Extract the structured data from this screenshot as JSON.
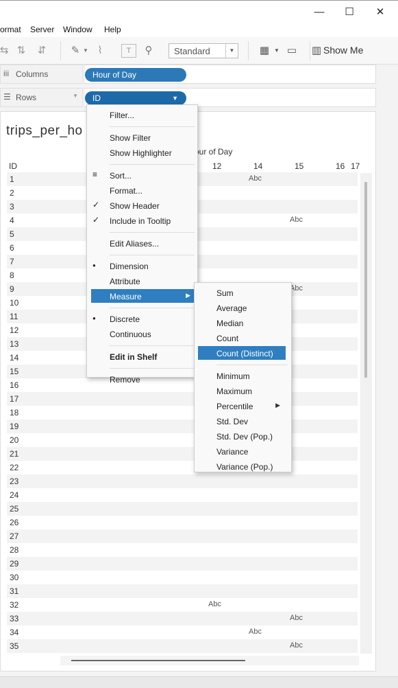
{
  "window": {
    "minimize": "—",
    "maximize": "☐",
    "close": "✕"
  },
  "menu": [
    "ormat",
    "Server",
    "Window",
    "Help"
  ],
  "toolbar": {
    "mode_value": "Standard",
    "show_me": "Show Me"
  },
  "shelves": {
    "columns_label": "Columns",
    "columns_pill": "Hour of Day",
    "rows_label": "Rows",
    "rows_pill": "ID"
  },
  "sheet": {
    "title": "trips_per_ho",
    "column_header": "our of Day",
    "id_header": "ID",
    "hour_ticks": [
      "12",
      "14",
      "15",
      "16",
      "17"
    ],
    "rows": [
      {
        "id": "1",
        "abc": "Abc",
        "col": "14"
      },
      {
        "id": "2"
      },
      {
        "id": "3"
      },
      {
        "id": "4",
        "abc": "Abc",
        "col": "15"
      },
      {
        "id": "5"
      },
      {
        "id": "6"
      },
      {
        "id": "7"
      },
      {
        "id": "8"
      },
      {
        "id": "9",
        "abc": "Abc",
        "col": "15"
      },
      {
        "id": "10"
      },
      {
        "id": "11"
      },
      {
        "id": "12"
      },
      {
        "id": "13"
      },
      {
        "id": "14"
      },
      {
        "id": "15"
      },
      {
        "id": "16"
      },
      {
        "id": "17"
      },
      {
        "id": "18"
      },
      {
        "id": "19"
      },
      {
        "id": "20"
      },
      {
        "id": "21"
      },
      {
        "id": "22"
      },
      {
        "id": "23"
      },
      {
        "id": "24"
      },
      {
        "id": "25"
      },
      {
        "id": "26"
      },
      {
        "id": "27"
      },
      {
        "id": "28"
      },
      {
        "id": "29"
      },
      {
        "id": "30"
      },
      {
        "id": "31"
      },
      {
        "id": "32",
        "abc": "Abc",
        "col": "12"
      },
      {
        "id": "33",
        "abc": "Abc",
        "col": "15"
      },
      {
        "id": "34",
        "abc": "Abc",
        "col": "14"
      },
      {
        "id": "35",
        "abc": "Abc",
        "col": "15"
      }
    ]
  },
  "context_menu": {
    "items": [
      {
        "label": "Filter..."
      },
      {
        "sep": true
      },
      {
        "label": "Show Filter"
      },
      {
        "label": "Show Highlighter"
      },
      {
        "sep": true
      },
      {
        "label": "Sort...",
        "mark": "sort-icon"
      },
      {
        "label": "Format..."
      },
      {
        "label": "Show Header",
        "mark": "check"
      },
      {
        "label": "Include in Tooltip",
        "mark": "check"
      },
      {
        "sep": true
      },
      {
        "label": "Edit Aliases..."
      },
      {
        "sep": true
      },
      {
        "label": "Dimension",
        "mark": "bullet"
      },
      {
        "label": "Attribute"
      },
      {
        "label": "Measure",
        "highlight": true,
        "submenu": true
      },
      {
        "sep": true
      },
      {
        "label": "Discrete",
        "mark": "bullet"
      },
      {
        "label": "Continuous"
      },
      {
        "sep": true
      },
      {
        "label": "Edit in Shelf",
        "bold": true
      },
      {
        "sep": true
      },
      {
        "label": "Remove"
      }
    ]
  },
  "measure_submenu": {
    "items": [
      {
        "label": "Sum"
      },
      {
        "label": "Average"
      },
      {
        "label": "Median"
      },
      {
        "label": "Count"
      },
      {
        "label": "Count (Distinct)",
        "highlight": true
      },
      {
        "sep": true
      },
      {
        "label": "Minimum"
      },
      {
        "label": "Maximum"
      },
      {
        "label": "Percentile",
        "submenu": true
      },
      {
        "label": "Std. Dev"
      },
      {
        "label": "Std. Dev (Pop.)"
      },
      {
        "label": "Variance"
      },
      {
        "label": "Variance (Pop.)"
      }
    ]
  },
  "colors": {
    "pill": "#2d79b8",
    "highlight": "#2f7fc0"
  }
}
